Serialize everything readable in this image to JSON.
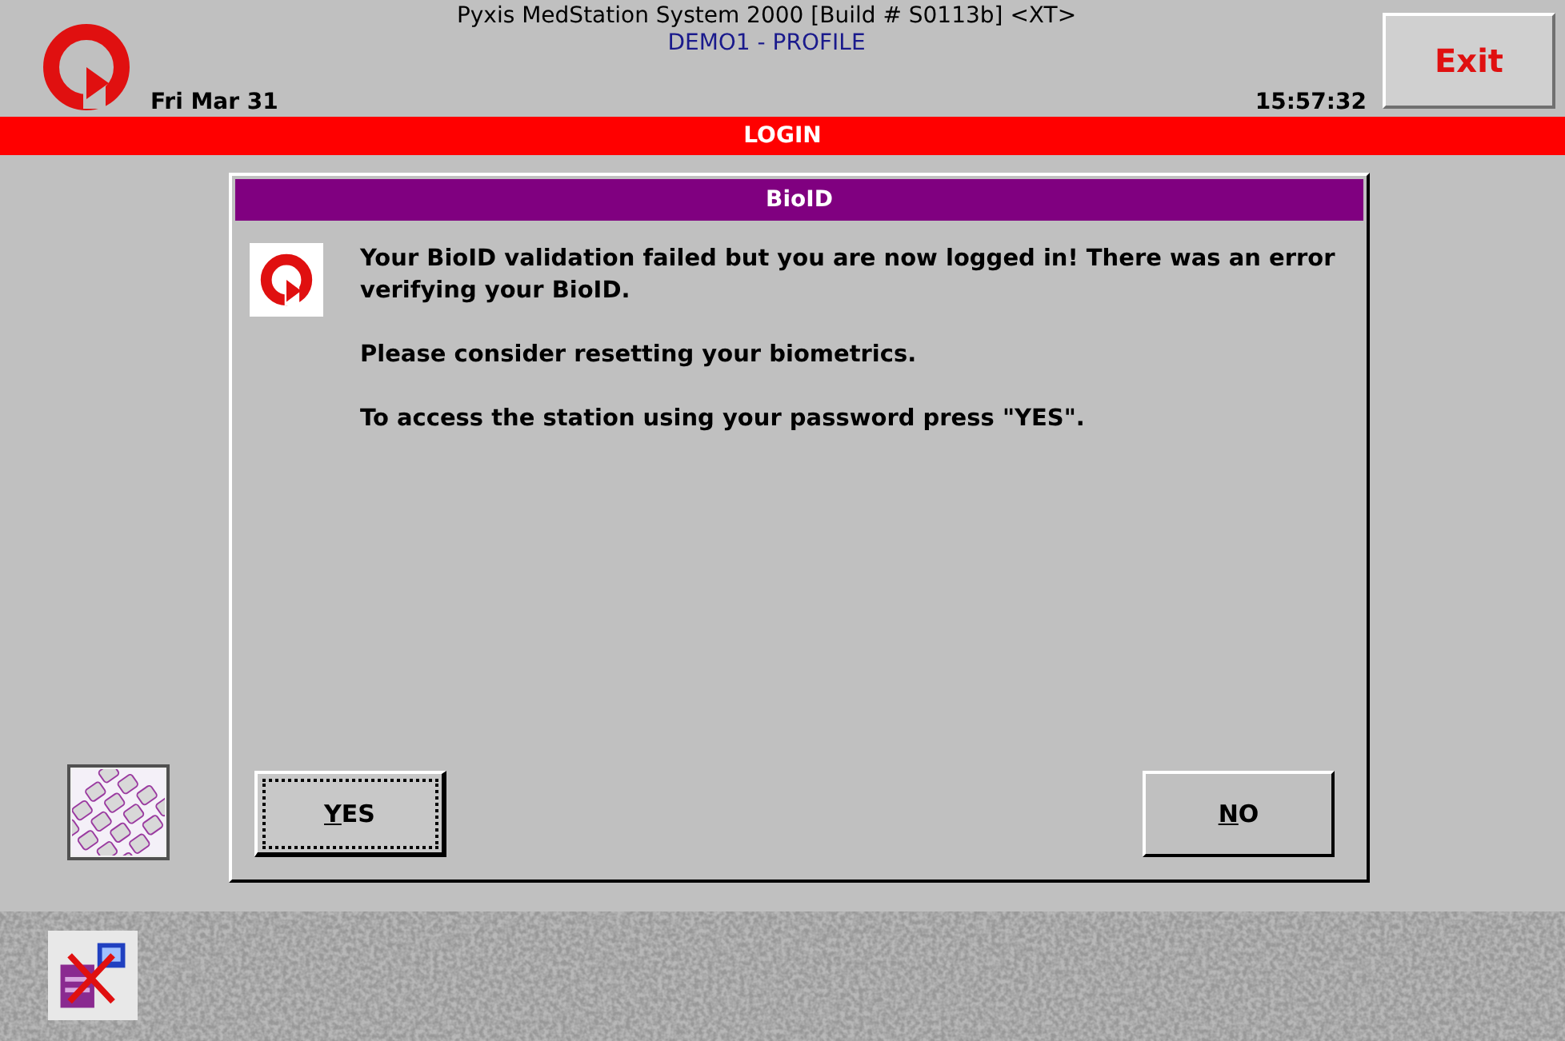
{
  "header": {
    "title": "Pyxis MedStation System 2000 [Build # S0113b] <XT>",
    "subtitle": "DEMO1 - PROFILE",
    "date": "Fri Mar 31",
    "time": "15:57:32",
    "exit_button": "Exit"
  },
  "banner": "LOGIN",
  "dialog": {
    "title": "BioID",
    "paragraphs": [
      "Your BioID validation failed but you are now logged in! There was an error verifying your BioID.",
      "Please consider resetting your biometrics.",
      "To access the station using your password press \"YES\"."
    ],
    "buttons": [
      {
        "label": "YES",
        "focused": true
      },
      {
        "label": "NO",
        "focused": false
      }
    ]
  }
}
